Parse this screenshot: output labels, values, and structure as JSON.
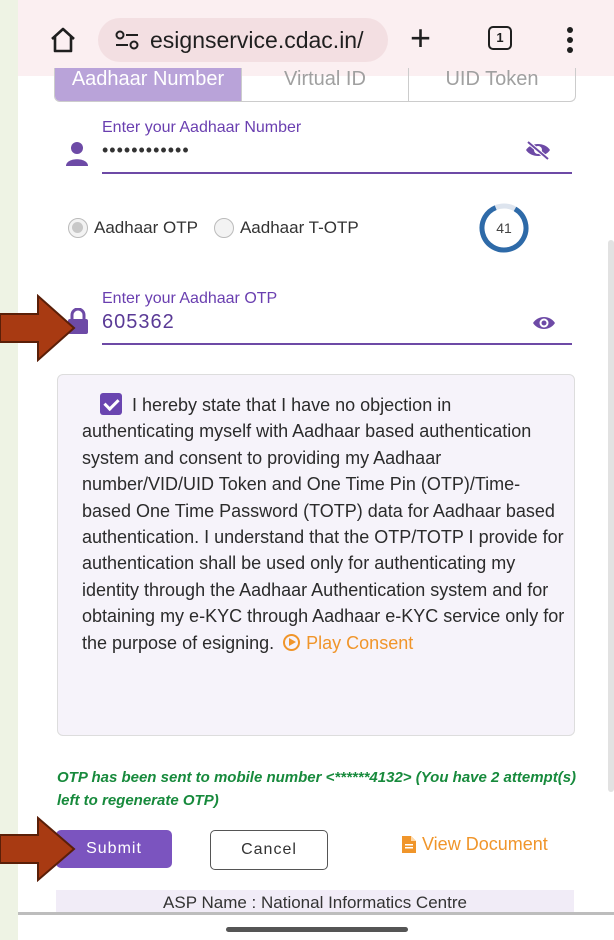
{
  "browser": {
    "url": "esignservice.cdac.in/",
    "tab_count": "1"
  },
  "id_tabs": [
    "Aadhaar Number",
    "Virtual ID",
    "UID Token"
  ],
  "aadhaar_field": {
    "label": "Enter your Aadhaar Number",
    "value": "••••••••••••"
  },
  "otp_type": {
    "options": [
      "Aadhaar OTP",
      "Aadhaar T-OTP"
    ],
    "selected": "Aadhaar OTP",
    "timer": "41"
  },
  "otp_field": {
    "label": "Enter your Aadhaar OTP",
    "value": "605362"
  },
  "consent": {
    "text": "I hereby state that I have no objection in authenticating myself with Aadhaar based authentication system and consent to providing my Aadhaar number/VID/UID Token and One Time Pin (OTP)/Time-based One Time Password (TOTP) data for Aadhaar based authentication. I understand that the OTP/TOTP I provide for authentication shall be used only for authenticating my identity through the Aadhaar Authentication system and for obtaining my e-KYC through Aadhaar e-KYC service only for the purpose of esigning.",
    "play_label": "Play Consent",
    "checked": true
  },
  "otp_message": "OTP has been sent to mobile number <******4132>   (You have 2 attempt(s) left to regenerate OTP)",
  "actions": {
    "submit": "Submit",
    "cancel": "Cancel",
    "view_document": "View Document"
  },
  "asp": {
    "label": "ASP Name",
    "value": "National Informatics Centre"
  },
  "colors": {
    "accent": "#6d4aa6",
    "orange": "#f0952a",
    "green": "#178a3c",
    "arrow": "#a83a12"
  }
}
